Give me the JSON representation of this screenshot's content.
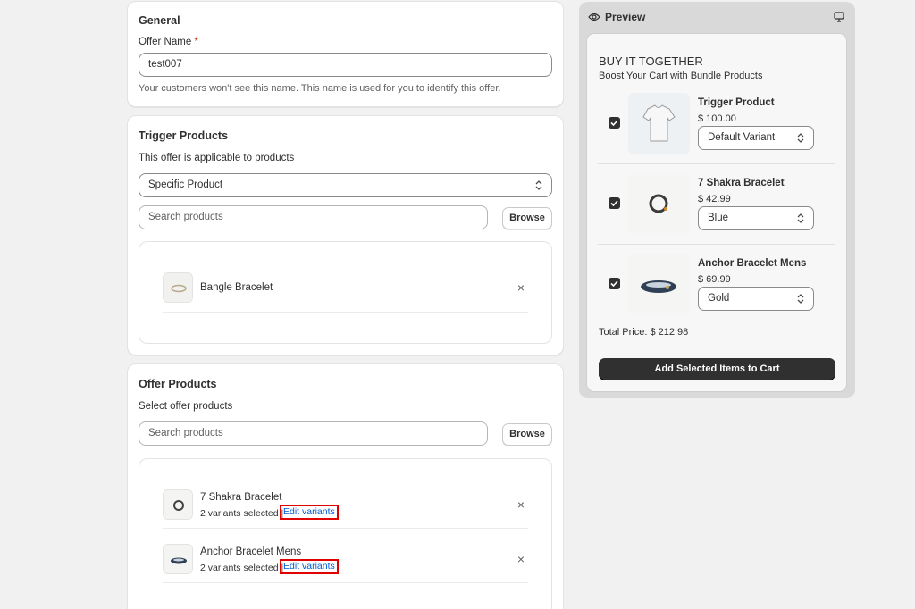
{
  "general": {
    "title": "General",
    "offer_name_label": "Offer Name",
    "required_mark": "*",
    "offer_name_value": "test007",
    "help_text": "Your customers won't see this name. This name is used for you to identify this offer."
  },
  "trigger": {
    "title": "Trigger Products",
    "applicable_label": "This offer is applicable to products",
    "select_value": "Specific Product",
    "search_placeholder": "Search products",
    "browse_label": "Browse",
    "products": [
      {
        "name": "Bangle Bracelet",
        "icon": "bracelet-thumbnail"
      }
    ],
    "remove_icon": "×"
  },
  "offer": {
    "title": "Offer Products",
    "select_label": "Select offer products",
    "search_placeholder": "Search products",
    "browse_label": "Browse",
    "products": [
      {
        "name": "7 Shakra Bracelet",
        "variants": "2 variants selected |",
        "edit_label": "Edit variants"
      },
      {
        "name": "Anchor Bracelet Mens",
        "variants": "2 variants selected |",
        "edit_label": "Edit variants"
      }
    ],
    "remove_icon": "×"
  },
  "preview": {
    "title": "Preview",
    "heading": "BUY IT TOGETHER",
    "subheading": "Boost Your Cart with Bundle Products",
    "items": [
      {
        "name": "Trigger Product",
        "price": "$ 100.00",
        "variant": "Default Variant"
      },
      {
        "name": "7 Shakra Bracelet",
        "price": "$ 42.99",
        "variant": "Blue"
      },
      {
        "name": "Anchor Bracelet Mens",
        "price": "$ 69.99",
        "variant": "Gold"
      }
    ],
    "total": "Total Price: $ 212.98",
    "cart_button": "Add Selected Items to Cart"
  },
  "colors": {
    "background": "#f1f1f1",
    "link": "#005bd3",
    "highlight": "#e00000",
    "dark_button": "#303030"
  }
}
